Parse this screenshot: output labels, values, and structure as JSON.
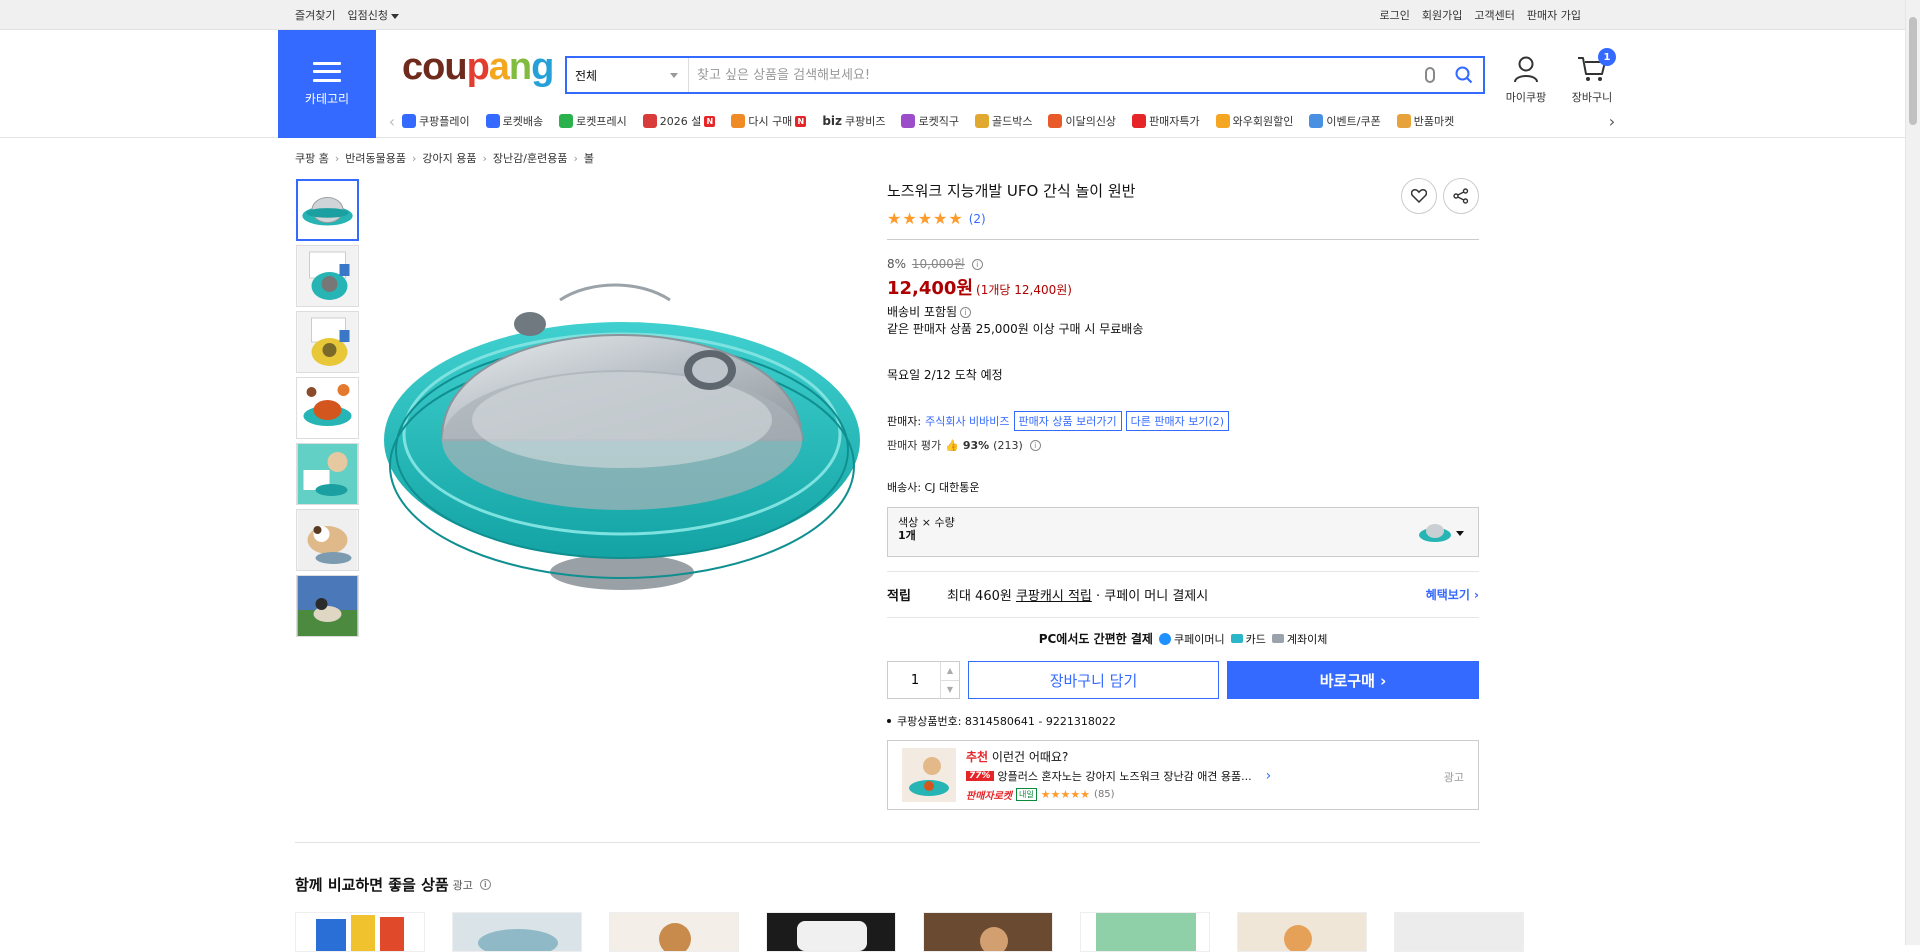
{
  "topbar": {
    "bookmarks": "즐겨찾기",
    "vendor_apply": "입점신청",
    "login": "로그인",
    "signup": "회원가입",
    "customer_center": "고객센터",
    "seller_signup": "판매자 가입"
  },
  "header": {
    "category_label": "카테고리",
    "logo": [
      "cou",
      "p",
      "a",
      "n",
      "g"
    ],
    "search_scope": "전체",
    "search_placeholder": "찾고 싶은 상품을 검색해보세요!",
    "mycoupang": "마이쿠팡",
    "cart": "장바구니",
    "cart_count": "1",
    "brand_color": "#346aff"
  },
  "subnav": [
    {
      "label": "쿠팡플레이",
      "icon": "play-icon",
      "color": "#346aff",
      "badge": ""
    },
    {
      "label": "로켓배송",
      "icon": "rocket-icon",
      "color": "#346aff",
      "badge": ""
    },
    {
      "label": "로켓프레시",
      "icon": "rocket-fresh-icon",
      "color": "#2bb24c",
      "badge": ""
    },
    {
      "label": "2026 설",
      "icon": "gift-icon",
      "color": "#d93b3b",
      "badge": "N"
    },
    {
      "label": "다시 구매",
      "icon": "home-icon",
      "color": "#f08a24",
      "badge": "N"
    },
    {
      "label": "쿠팡비즈",
      "icon": "biz-icon",
      "color": "#333333",
      "badge": "",
      "prefix": "biz"
    },
    {
      "label": "로켓직구",
      "icon": "global-icon",
      "color": "#9b4dca",
      "badge": ""
    },
    {
      "label": "골드박스",
      "icon": "goldbox-icon",
      "color": "#e0a82e",
      "badge": ""
    },
    {
      "label": "이달의신상",
      "icon": "new-icon",
      "color": "#e85a2a",
      "badge": ""
    },
    {
      "label": "판매자특가",
      "icon": "percent-icon",
      "color": "#e52528",
      "badge": ""
    },
    {
      "label": "와우회원할인",
      "icon": "wow-icon",
      "color": "#f5a623",
      "badge": ""
    },
    {
      "label": "이벤트/쿠폰",
      "icon": "coupon-icon",
      "color": "#4a90e2",
      "badge": ""
    },
    {
      "label": "반품마켓",
      "icon": "return-icon",
      "color": "#e8a23b",
      "badge": ""
    }
  ],
  "breadcrumb": [
    "쿠팡 홈",
    "반려동물용품",
    "강아지 용품",
    "장난감/훈련용품",
    "볼"
  ],
  "product": {
    "title": "노즈워크 지능개발 UFO 간식 놀이 원반",
    "rating_count": "(2)",
    "stars": 5,
    "discount": "8%",
    "original_price": "10,000원",
    "price": "12,400원",
    "unit_price": "(1개당 12,400원)",
    "shipping": "배송비 포함됨",
    "free_shipping_note": "같은 판매자 상품 25,000원 이상 구매 시 무료배송",
    "arrival": "목요일 2/12 도착 예정",
    "seller_label": "판매자:",
    "seller_name": "주식회사 비바비즈",
    "seller_products": "판매자 상품 보러가기",
    "other_sellers": "다른 판매자 보기(2)",
    "seller_rating_label": "판매자 평가",
    "seller_rating": "93%",
    "seller_rating_count": "(213)",
    "carrier": "배송사: CJ 대한통운",
    "option_label": "색상 × 수량",
    "option_value": "1개",
    "earn_title": "적립",
    "earn_text_1": "최대 460원",
    "earn_text_2": "쿠팡캐시 적립",
    "earn_text_3": "· 쿠페이 머니 결제시",
    "earn_more": "혜택보기 ›",
    "pay_title": "PC에서도 간편한 결제",
    "pay_methods": [
      "쿠페이머니",
      "카드",
      "계좌이체"
    ],
    "quantity": "1",
    "add_to_cart": "장바구니 담기",
    "buy_now": "바로구매 ›",
    "product_number": "쿠팡상품번호: 8314580641 - 9221318022"
  },
  "recommend": {
    "prefix": "추천",
    "title": "이런건 어때요?",
    "discount": "77%",
    "name": "앙플러스 혼자노는 강아지 노즈워크 장난감 애견 용품...",
    "rocket": "판매자로켓",
    "delivery_badge": "내일",
    "reviews": "(85)",
    "ad": "광고"
  },
  "compare": {
    "title": "함께 비교하면 좋을 상품",
    "ad": "광고"
  }
}
